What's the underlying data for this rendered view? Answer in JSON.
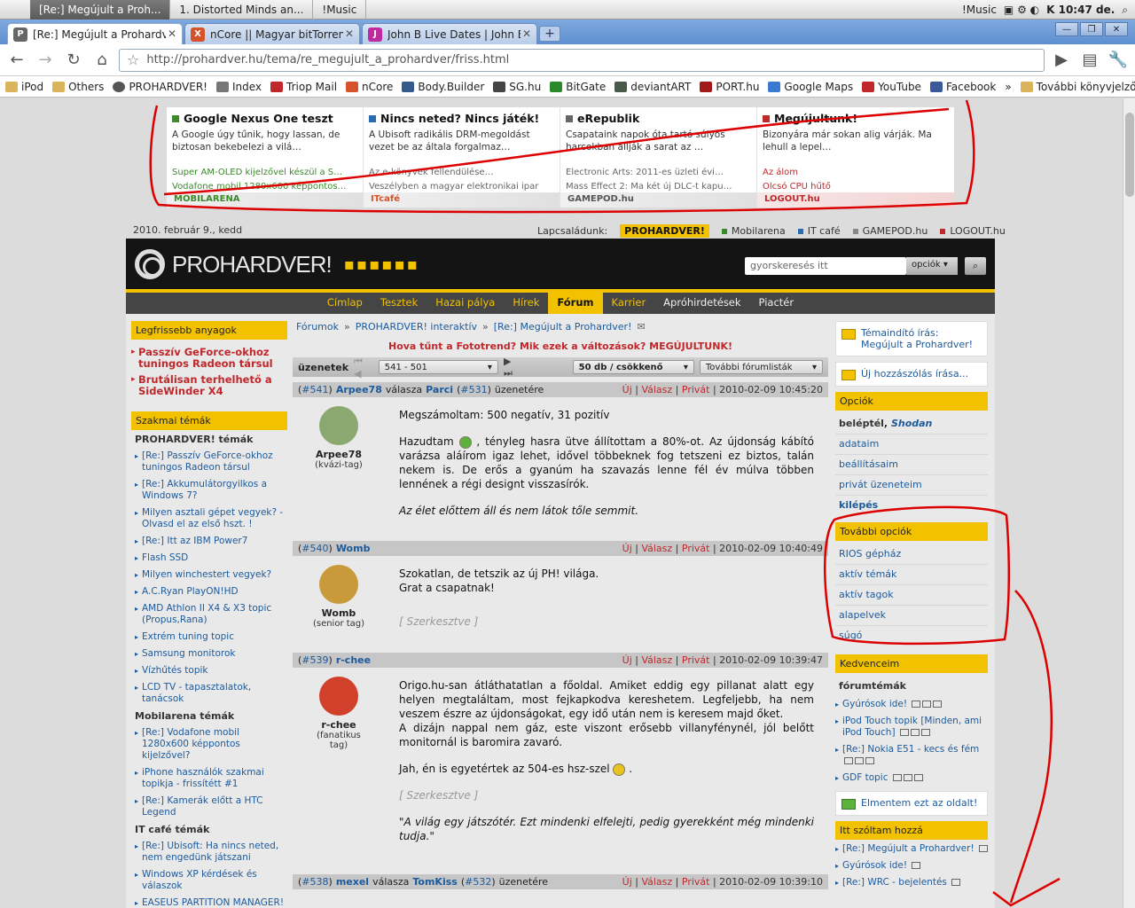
{
  "os_menubar": {
    "tabs": [
      "[Re:] Megújult a Proh...",
      "1. Distorted Minds an...",
      "!Music"
    ],
    "right_music": "!Music",
    "clock": "K 10:47 de."
  },
  "browser": {
    "tabs": [
      {
        "label": "[Re:] Megújult a Prohardv...",
        "active": true
      },
      {
        "label": "nCore || Magyar bitTorren...",
        "active": false
      },
      {
        "label": "John B Live Dates | John B",
        "active": false
      }
    ],
    "url": "http://prohardver.hu/tema/re_megujult_a_prohardver/friss.html",
    "bookmarks": [
      "iPod",
      "Others",
      "PROHARDVER!",
      "Index",
      "Triop Mail",
      "nCore",
      "Body.Builder",
      "SG.hu",
      "BitGate",
      "deviantART",
      "PORT.hu",
      "Google Maps",
      "YouTube",
      "Facebook",
      "További könyvjelzők"
    ]
  },
  "promo": [
    {
      "title": "Google Nexus One teszt",
      "text": "A Google úgy tűnik, hogy lassan, de biztosan bekebelezi a vilá…",
      "links": [
        "Super AM-OLED kijelzővel készül a S…",
        "Vodafone mobil 1280x600 képpontos…"
      ],
      "site": "MOBILARENA",
      "color": "#3a8a2a"
    },
    {
      "title": "Nincs neted? Nincs játék!",
      "text": "A Ubisoft radikális DRM-megoldást vezet be az általa forgalmaz…",
      "links": [
        "Az e-könyvek fellendülése…",
        "Veszélyben a magyar elektronikai ipar"
      ],
      "site": "ITcafé",
      "color": "#2a6ab0"
    },
    {
      "title": "eRepublik",
      "text": "Csapataink napok óta tartó súlyos harcokban állják a sarat az …",
      "links": [
        "Electronic Arts: 2011-es üzleti évi…",
        "Mass Effect 2: Ma két új DLC-t kapu…"
      ],
      "site": "GAMEPOD.hu",
      "color": "#666666"
    },
    {
      "title": "Megújultunk!",
      "text": "Bizonyára már sokan alig várják. Ma lehull a lepel…",
      "links": [
        "Az álom",
        "Olcsó CPU hűtő"
      ],
      "site": "LOGOUT.hu",
      "color": "#c0282c"
    }
  ],
  "subheader": {
    "date": "2010. február 9., kedd",
    "family_label": "Lapcsaládunk:",
    "family": [
      "PROHARDVER!",
      "Mobilarena",
      "IT café",
      "GAMEPOD.hu",
      "LOGOUT.hu"
    ]
  },
  "header": {
    "logo": "PROHARDVER!",
    "search_placeholder": "gyorskeresés itt",
    "options": "opciók"
  },
  "nav": [
    "Címlap",
    "Tesztek",
    "Hazai pálya",
    "Hírek",
    "Fórum",
    "Karrier",
    "Apróhirdetések",
    "Piactér"
  ],
  "left": {
    "latest_head": "Legfrissebb anyagok",
    "latest": [
      "Passzív GeForce-okhoz tuningos Radeon társul",
      "Brutálisan terhelhető a SideWinder X4"
    ],
    "pro_head": "Szakmai témák",
    "groups": [
      {
        "title": "PROHARDVER! témák",
        "items": [
          "[Re:] Passzív GeForce-okhoz tuningos Radeon társul",
          "[Re:] Akkumulátorgyilkos a Windows 7?",
          "Milyen asztali gépet vegyek? - Olvasd el az első hszt. !",
          "[Re:] Itt az IBM Power7",
          "Flash SSD",
          "Milyen winchestert vegyek?",
          "A.C.Ryan PlayON!HD",
          "AMD Athlon II X4 & X3 topic (Propus,Rana)",
          "Extrém tuning topic",
          "Samsung monitorok",
          "Vízhűtés topik",
          "LCD TV - tapasztalatok, tanácsok"
        ]
      },
      {
        "title": "Mobilarena témák",
        "items": [
          "[Re:] Vodafone mobil 1280x600 képpontos kijelzővel?",
          "iPhone használók szakmai topikja - frissítétt #1",
          "[Re:] Kamerák előtt a HTC Legend"
        ]
      },
      {
        "title": "IT café témák",
        "items": [
          "[Re:] Ubisoft: Ha nincs neted, nem engedünk játszani",
          "Windows XP kérdések és válaszok",
          "EASEUS PARTITION MANAGER!"
        ]
      }
    ]
  },
  "main": {
    "breadcrumb": [
      "Fórumok",
      "PROHARDVER! interaktív",
      "[Re:] Megújult a Prohardver!"
    ],
    "headline": "Hova tűnt a Fototrend? Mik ezek a változások? MEGÚJULTUNK!",
    "msgbar": {
      "label": "üzenetek",
      "range": "541 - 501",
      "per_page": "50 db / csökkenő",
      "more": "További fórumlisták"
    },
    "post_actions": [
      "Új",
      "Válasz",
      "Privát"
    ],
    "reply_word": "válasza",
    "reply_suffix": "üzenetére",
    "posts": [
      {
        "num": "#541",
        "author": "Arpee78",
        "reply_to": "Parci",
        "reply_num": "#531",
        "date": "2010-02-09 10:45:20",
        "rank": "(kvázi-tag)",
        "p1": "Megszámoltam: 500 negatív, 31 pozitív",
        "p2a": "Hazudtam",
        "p2b": ", tényleg hasra ütve állítottam a 80%-ot. Az újdonság kábító varázsa aláírom igaz lehet, idővel többeknek fog tetszeni ez biztos, talán nekem is. De erős a gyanúm ha szavazás lenne fél év múlva többen lennének a régi designt visszasírók.",
        "sig": "Az élet előttem áll és nem látok tőle semmit."
      },
      {
        "num": "#540",
        "author": "Womb",
        "date": "2010-02-09 10:40:49",
        "rank": "(senior tag)",
        "p1": "Szokatlan, de tetszik az új PH! világa.",
        "p2": "Grat a csapatnak!",
        "edit": "[ Szerkesztve ]"
      },
      {
        "num": "#539",
        "author": "r-chee",
        "date": "2010-02-09 10:39:47",
        "rank": "(fanatikus tag)",
        "p1": "Origo.hu-san átláthatatlan a főoldal. Amiket eddig egy pillanat alatt egy helyen megtaláltam, most fejkapkodva kereshetem. Legfeljebb, ha nem veszem észre az újdonságokat, egy idő után nem is keresem majd őket.",
        "p2": "A dizájn nappal nem gáz, este viszont erősebb villanyfénynél, jól belőtt monitornál is baromira zavaró.",
        "p3a": "Jah, én is egyetértek az 504-es hsz-szel",
        "p3b": ".",
        "edit": "[ Szerkesztve ]",
        "sig": "\"A világ egy játszótér. Ezt mindenki elfelejti, pedig gyerekként még mindenki tudja.\""
      },
      {
        "num": "#538",
        "author": "mexel",
        "reply_to": "TomKiss",
        "reply_num": "#532",
        "date": "2010-02-09 10:39:10"
      }
    ]
  },
  "right": {
    "starter": "Témaindító írás: Megújult a Prohardver!",
    "new_post": "Új hozzászólás írása...",
    "options_head": "Opciók",
    "logged_in_label": "beléptél,",
    "username": "Shodan",
    "options": [
      "adataim",
      "beállításaim",
      "privát üzeneteim"
    ],
    "logout": "kilépés",
    "more_head": "További opciók",
    "more": [
      "RIOS gépház",
      "aktív témák",
      "aktív tagok",
      "alapelvek",
      "súgó"
    ],
    "fav_head": "Kedvenceim",
    "fav_sub": "fórumtémák",
    "favs": [
      "Gyúrósok ide!",
      "iPod Touch topik [Minden, ami iPod Touch]",
      "[Re:] Nokia E51 - kecs és fém",
      "GDF topic"
    ],
    "save_page": "Elmentem ezt az oldalt!",
    "spoke_head": "Itt szóltam hozzá",
    "spoke": [
      "[Re:] Megújult a Prohardver!",
      "Gyúrósok ide!",
      "[Re:] WRC - bejelentés"
    ]
  }
}
